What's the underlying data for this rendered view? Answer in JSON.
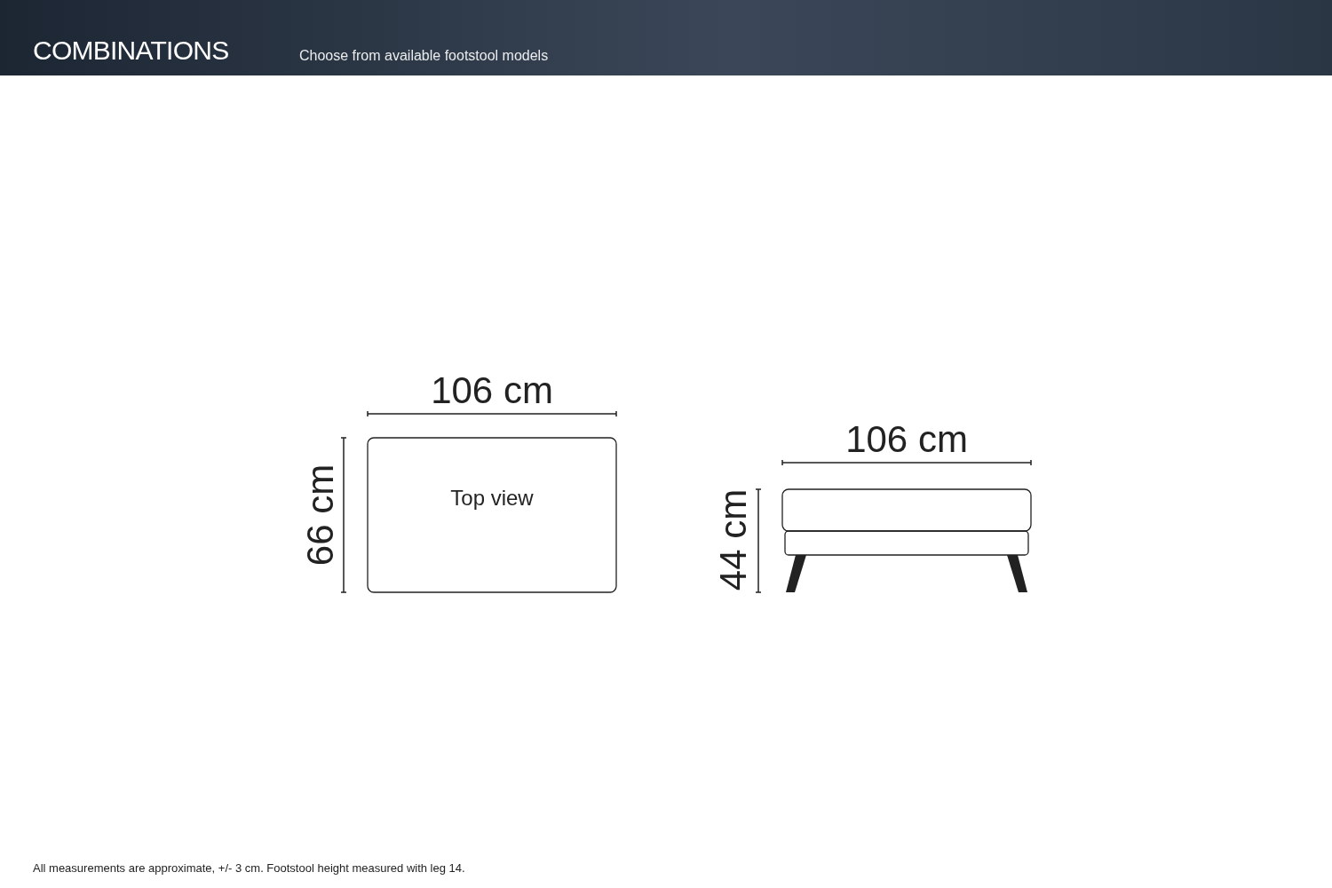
{
  "header": {
    "title": "COMBINATIONS",
    "subtitle": "Choose from available footstool models"
  },
  "diagrams": [
    {
      "kind": "top_view",
      "width_label": "106 cm",
      "depth_label": "66 cm",
      "caption": "Top view"
    },
    {
      "kind": "side_view",
      "width_label": "106 cm",
      "height_label": "44 cm"
    }
  ],
  "footnote": "All measurements are approximate, +/- 3 cm. Footstool height measured with leg 14."
}
